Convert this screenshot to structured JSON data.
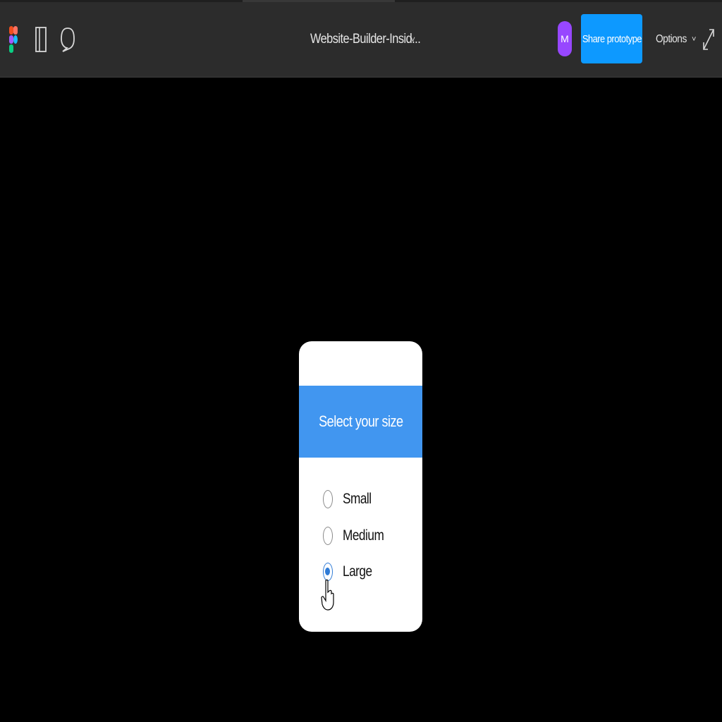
{
  "toolbar": {
    "file_title": "Website-Builder-Insid...",
    "title_caret": "˅",
    "avatar_initial": "M",
    "share_label": "Share prototype",
    "options_label": "Options",
    "options_caret": "˅",
    "icons": [
      "figma-logo-icon",
      "sidebar-panel-icon",
      "comment-icon",
      "expand-icon",
      "chevron-down-icon"
    ]
  },
  "colors": {
    "toolbar_bg": "#2c2c2c",
    "canvas_bg": "#000000",
    "share_button": "#0d99ff",
    "avatar": "#9747ff",
    "card_header": "#4196f0",
    "radio_selected": "#2f7bd6"
  },
  "prototype": {
    "header": "Select your size",
    "options": [
      {
        "label": "Small",
        "selected": false
      },
      {
        "label": "Medium",
        "selected": false
      },
      {
        "label": "Large",
        "selected": true
      }
    ]
  }
}
